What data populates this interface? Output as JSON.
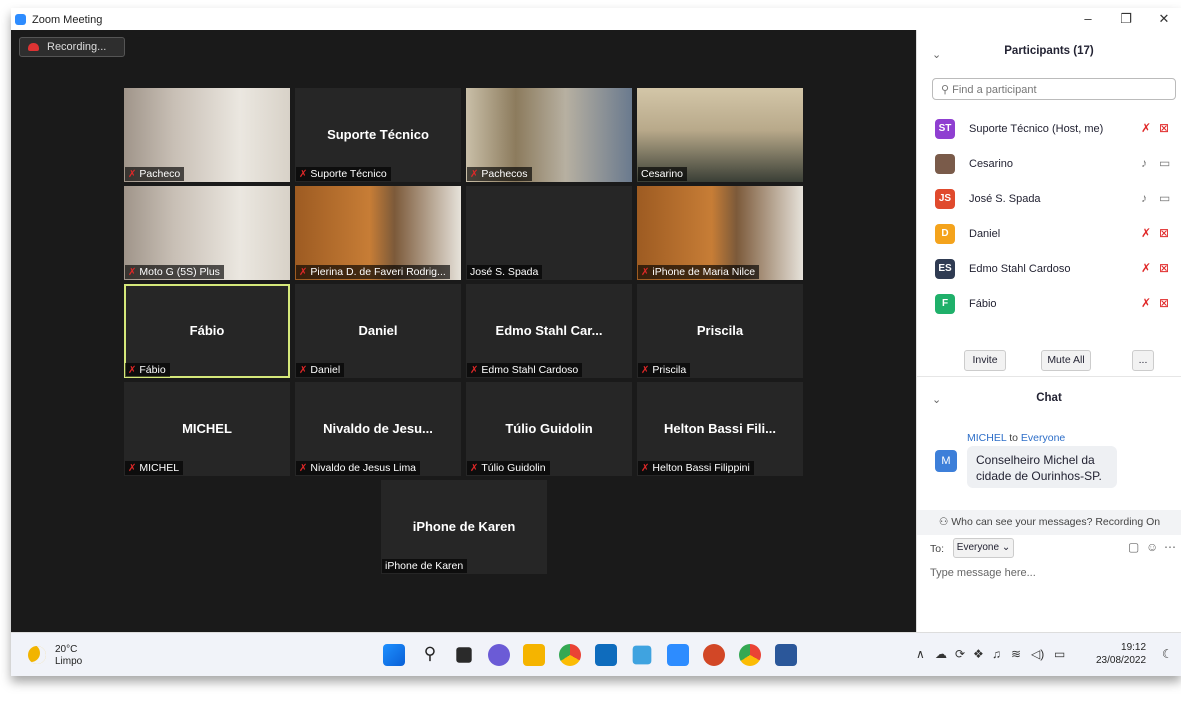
{
  "window": {
    "title": "Zoom Meeting",
    "minimize": "–",
    "restore": "❐",
    "close": "✕"
  },
  "recording": "Recording...",
  "tiles": [
    {
      "center": "",
      "label": "Pacheco",
      "muted": true,
      "video": "v1"
    },
    {
      "center": "Suporte Técnico",
      "label": "Suporte Técnico",
      "muted": true,
      "video": ""
    },
    {
      "center": "",
      "label": "Pachecos",
      "muted": true,
      "video": "v3"
    },
    {
      "center": "",
      "label": "Cesarino",
      "muted": false,
      "video": "v4"
    },
    {
      "center": "",
      "label": "Moto G (5S) Plus",
      "muted": true,
      "video": "v1"
    },
    {
      "center": "",
      "label": "Pierina D. de Faveri Rodrig...",
      "muted": true,
      "video": "v6"
    },
    {
      "center": "",
      "label": "José S. Spada",
      "muted": false,
      "video": ""
    },
    {
      "center": "",
      "label": "iPhone de Maria Nilce",
      "muted": true,
      "video": "v6"
    },
    {
      "center": "Fábio",
      "label": "Fábio",
      "muted": true,
      "video": "",
      "active": true
    },
    {
      "center": "Daniel",
      "label": "Daniel",
      "muted": true,
      "video": ""
    },
    {
      "center": "Edmo Stahl Car...",
      "label": "Edmo Stahl Cardoso",
      "muted": true,
      "video": ""
    },
    {
      "center": "Priscila",
      "label": "Priscila",
      "muted": true,
      "video": ""
    },
    {
      "center": "MICHEL",
      "label": "MICHEL",
      "muted": true,
      "video": ""
    },
    {
      "center": "Nivaldo de Jesu...",
      "label": "Nivaldo de Jesus Lima",
      "muted": true,
      "video": ""
    },
    {
      "center": "Túlio Guidolin",
      "label": "Túlio Guidolin",
      "muted": true,
      "video": ""
    },
    {
      "center": "Helton Bassi Fili...",
      "label": "Helton Bassi Filippini",
      "muted": true,
      "video": ""
    },
    {
      "center": "iPhone de Karen",
      "label": "iPhone de Karen",
      "muted": false,
      "video": ""
    }
  ],
  "participants_panel": {
    "title": "Participants (17)",
    "search_placeholder": "Find a participant",
    "list": [
      {
        "initials": "ST",
        "color": "#8f3fd1",
        "name": "Suporte Técnico (Host, me)",
        "muted": true
      },
      {
        "initials": "",
        "color": "#7a5b4a",
        "name": "Cesarino",
        "muted": false
      },
      {
        "initials": "JS",
        "color": "#e04a2d",
        "name": "José S. Spada",
        "muted": false
      },
      {
        "initials": "D",
        "color": "#f4a31c",
        "name": "Daniel",
        "muted": true
      },
      {
        "initials": "ES",
        "color": "#2f3b52",
        "name": "Edmo Stahl Cardoso",
        "muted": true
      },
      {
        "initials": "F",
        "color": "#1fb06a",
        "name": "Fábio",
        "muted": true
      }
    ],
    "invite": "Invite",
    "mute_all": "Mute All",
    "more": "..."
  },
  "chat": {
    "title": "Chat",
    "sender": "MICHEL",
    "to_word": "to",
    "recipient": "Everyone",
    "avatar": "M",
    "message": "Conselheiro Michel da cidade de Ourinhos-SP.",
    "who_can_see": "Who can see your messages? Recording On",
    "to_label": "To:",
    "to_value": "Everyone ⌄",
    "placeholder": "Type message here..."
  },
  "taskbar": {
    "temp": "20°C",
    "condition": "Limpo",
    "time": "19:12",
    "date": "23/08/2022"
  },
  "colors": {
    "meeting_bg": "#1a1a1a",
    "tile_bg": "#262626",
    "active_border": "#d5e87a",
    "mute_red": "#e02828",
    "zoom_blue": "#2d8cff"
  }
}
